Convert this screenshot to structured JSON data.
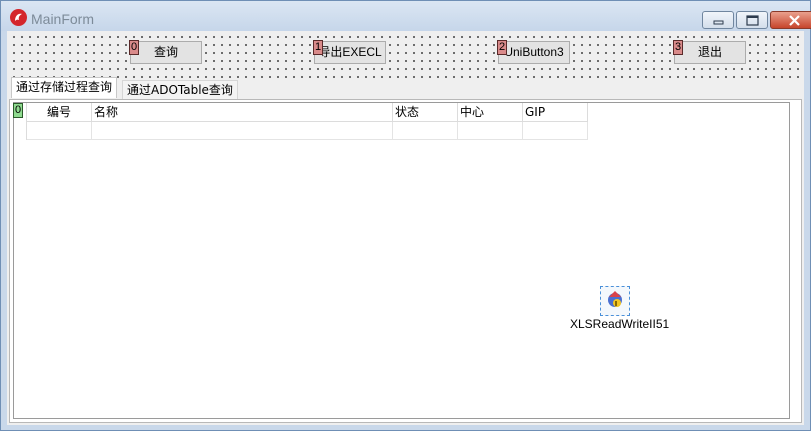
{
  "window": {
    "title": "MainForm"
  },
  "toolbar": {
    "buttons": [
      {
        "tag": "0",
        "label": "查询"
      },
      {
        "tag": "1",
        "label": "导出EXECL"
      },
      {
        "tag": "2",
        "label": "UniButton3"
      },
      {
        "tag": "3",
        "label": "退出"
      }
    ]
  },
  "tabs": [
    {
      "label": "通过存储过程查询",
      "active": true
    },
    {
      "label": "通过ADOTable查询",
      "active": false
    }
  ],
  "grid": {
    "indicator_tag": "0",
    "columns": [
      "编号",
      "名称",
      "状态",
      "中心",
      "GIP"
    ]
  },
  "component": {
    "label": "XLSReadWriteII51",
    "icon": "xls-component-icon"
  }
}
